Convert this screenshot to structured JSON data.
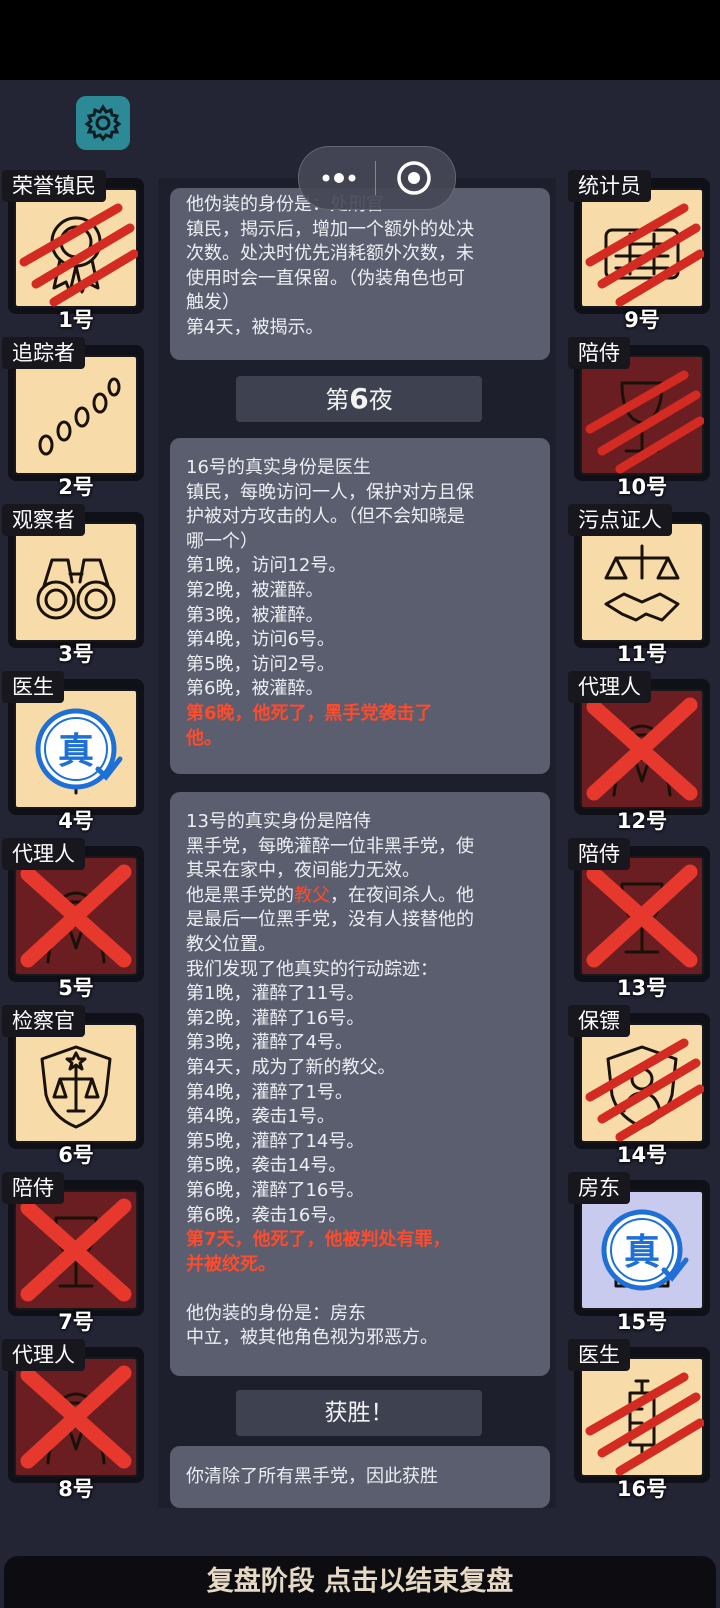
{
  "icons": {
    "settings": "gear-icon",
    "menu": "more-dots-icon",
    "close": "target-circle-icon"
  },
  "colors": {
    "highlight_red": "#ff4a2b",
    "card_beige": "#f7dcaa",
    "card_dead": "#6b1e22",
    "card_purple": "#c8cbee",
    "truth_badge": "#1e6fd6"
  },
  "cards_left": [
    {
      "role": "荣誉镇民",
      "number": "1号",
      "state": "slashed"
    },
    {
      "role": "追踪者",
      "number": "2号",
      "state": "alive"
    },
    {
      "role": "观察者",
      "number": "3号",
      "state": "alive"
    },
    {
      "role": "医生",
      "number": "4号",
      "state": "revealed",
      "badge": "真"
    },
    {
      "role": "代理人",
      "number": "5号",
      "state": "crossed"
    },
    {
      "role": "检察官",
      "number": "6号",
      "state": "alive"
    },
    {
      "role": "陪侍",
      "number": "7号",
      "state": "crossed"
    },
    {
      "role": "代理人",
      "number": "8号",
      "state": "crossed"
    }
  ],
  "cards_right": [
    {
      "role": "统计员",
      "number": "9号",
      "state": "slashed"
    },
    {
      "role": "陪侍",
      "number": "10号",
      "state": "slashed"
    },
    {
      "role": "污点证人",
      "number": "11号",
      "state": "alive"
    },
    {
      "role": "代理人",
      "number": "12号",
      "state": "crossed"
    },
    {
      "role": "陪侍",
      "number": "13号",
      "state": "crossed"
    },
    {
      "role": "保镖",
      "number": "14号",
      "state": "slashed"
    },
    {
      "role": "房东",
      "number": "15号",
      "state": "revealed",
      "badge": "真"
    },
    {
      "role": "医生",
      "number": "16号",
      "state": "slashed"
    }
  ],
  "log": {
    "panel1": [
      "他伪装的身份是：处刑官",
      "镇民，揭示后，增加一个额外的处决",
      "次数。处决时优先消耗额外次数，未",
      "使用时会一直保留。（伪装角色也可",
      "触发）",
      "第4天，被揭示。"
    ],
    "night_header_prefix": "第",
    "night_header_num": "6",
    "night_header_suffix": "夜",
    "panel2": [
      "16号的真实身份是医生",
      "镇民，每晚访问一人，保护对方且保",
      "护被对方攻击的人。（但不会知晓是",
      "哪一个）",
      "第1晚，访问12号。",
      "第2晚，被灌醉。",
      "第3晚，被灌醉。",
      "第4晚，访问6号。",
      "第5晚，访问2号。",
      "第6晚，被灌醉。"
    ],
    "panel2_death": [
      "第6晚，他死了，黑手党袭击了",
      "他。"
    ],
    "panel3_a": [
      "13号的真实身份是陪侍",
      "黑手党，每晚灌醉一位非黑手党，使",
      "其呆在家中，夜间能力无效。"
    ],
    "panel3_godfather_pre": "他是黑手党的",
    "panel3_godfather_word": "教父",
    "panel3_godfather_post": "，在夜间杀人。他",
    "panel3_b": [
      "是最后一位黑手党，没有人接替他的",
      "教父位置。",
      "我们发现了他真实的行动踪迹：",
      "第1晚，灌醉了11号。",
      "第2晚，灌醉了16号。",
      "第3晚，灌醉了4号。",
      "第4天，成为了新的教父。",
      "第4晚，灌醉了1号。",
      "第4晚，袭击1号。",
      "第5晚，灌醉了14号。",
      "第5晚，袭击14号。",
      "第6晚，灌醉了16号。",
      "第6晚，袭击16号。"
    ],
    "panel3_death": [
      "第7天，他死了，他被判处有罪，",
      "并被绞死。"
    ],
    "panel3_c": [
      "他伪装的身份是：房东",
      "中立，被其他角色视为邪恶方。"
    ],
    "victory_header": "获胜！",
    "victory_text": "你清除了所有黑手党，因此获胜"
  },
  "bottom_button": "复盘阶段 点击以结束复盘"
}
